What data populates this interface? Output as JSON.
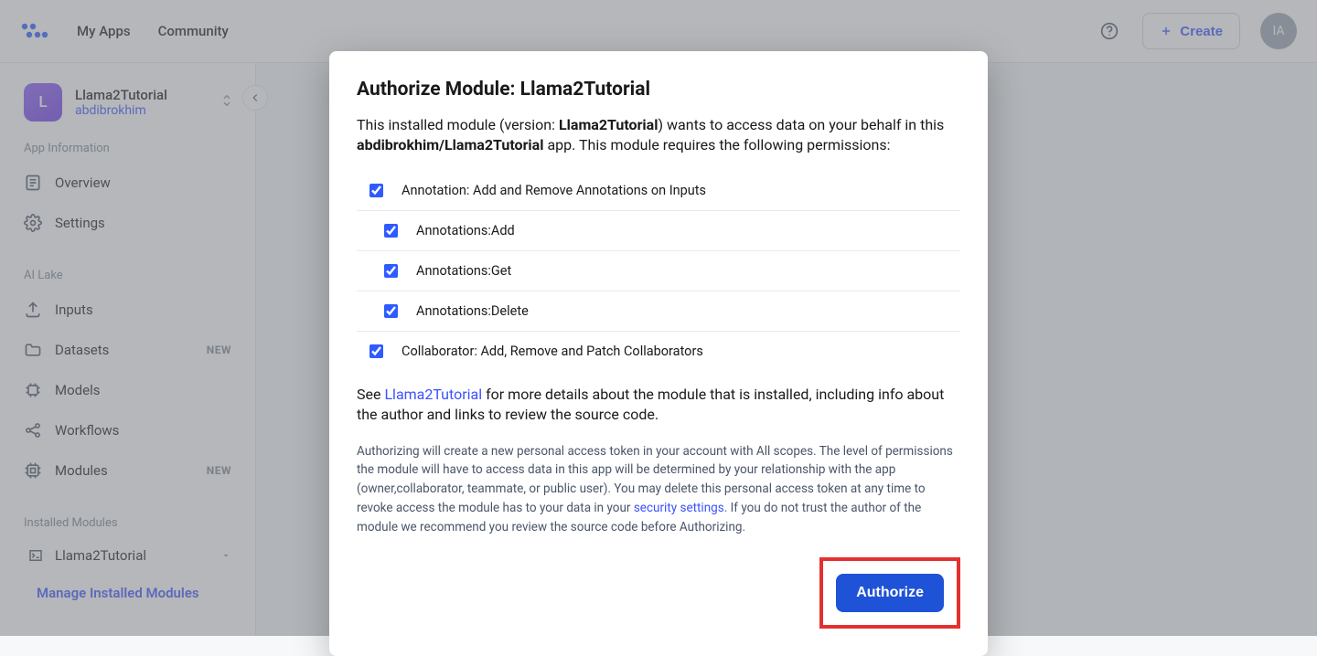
{
  "header": {
    "nav": [
      "My Apps",
      "Community"
    ],
    "create_label": "Create",
    "avatar_initials": "IA"
  },
  "sidebar": {
    "app_initial": "L",
    "app_name": "Llama2Tutorial",
    "app_user": "abdibrokhim",
    "sections": {
      "app_info": "App Information",
      "ai_lake": "AI Lake",
      "installed": "Installed Modules"
    },
    "items": {
      "overview": "Overview",
      "settings": "Settings",
      "inputs": "Inputs",
      "datasets": "Datasets",
      "models": "Models",
      "workflows": "Workflows",
      "modules": "Modules",
      "badge_new": "NEW",
      "installed_module": "Llama2Tutorial",
      "manage": "Manage Installed Modules"
    }
  },
  "modal": {
    "title": "Authorize Module: Llama2Tutorial",
    "lead_pre": "This installed module (version: ",
    "lead_version": "Llama2Tutorial",
    "lead_mid": ") wants to access data on your behalf in this ",
    "lead_app": "abdibrokhim/Llama2Tutorial",
    "lead_post": " app. This module requires the following permissions:",
    "permissions": [
      {
        "label": "Annotation: Add and Remove Annotations on Inputs",
        "child": false
      },
      {
        "label": "Annotations:Add",
        "child": true
      },
      {
        "label": "Annotations:Get",
        "child": true
      },
      {
        "label": "Annotations:Delete",
        "child": true
      },
      {
        "label": "Collaborator: Add, Remove and Patch Collaborators",
        "child": false
      }
    ],
    "see_more_pre": "See ",
    "see_more_link": "Llama2Tutorial",
    "see_more_post": " for more details about the module that is installed, including info about the author and links to review the source code.",
    "fineprint_pre": "Authorizing will create a new personal access token in your account with All scopes. The level of permissions the module will have to access data in this app will be determined by your relationship with the app (owner,collaborator, teammate, or public user). You may delete this personal access token at any time to revoke access the module has to your data in your ",
    "fineprint_link": "security settings",
    "fineprint_post": ". If you do not trust the author of the module we recommend you review the source code before Authorizing.",
    "authorize_label": "Authorize"
  }
}
